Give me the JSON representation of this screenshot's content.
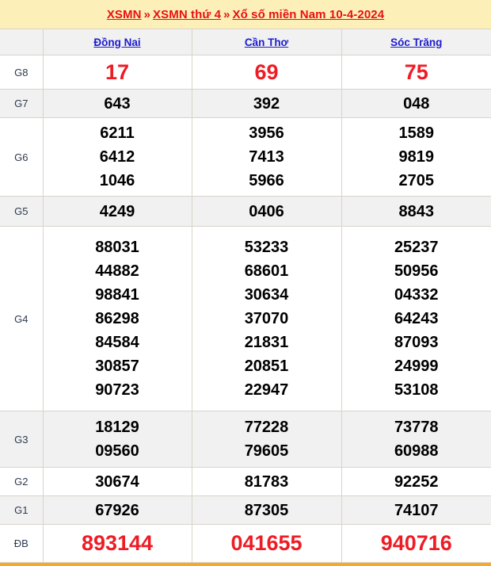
{
  "header": {
    "crumbs": [
      {
        "text": "XSMN",
        "type": "link"
      },
      {
        "text": "»",
        "type": "sep"
      },
      {
        "text": "XSMN thứ 4",
        "type": "link"
      },
      {
        "text": "»",
        "type": "sep"
      },
      {
        "text": "Xổ số miền Nam 10-4-2024",
        "type": "link"
      }
    ],
    "bg_color": "#fdefb8",
    "link_color": "#e8100f"
  },
  "table": {
    "columns": [
      {
        "label": ""
      },
      {
        "label": "Đồng Nai"
      },
      {
        "label": "Cần Thơ"
      },
      {
        "label": "Sóc Trăng"
      }
    ],
    "header_color": "#1b1bcf",
    "highlight_color": "#ee1c25",
    "rows": [
      {
        "prize": "G8",
        "dongnai": [
          "17"
        ],
        "cantho": [
          "69"
        ],
        "soctrang": [
          "75"
        ]
      },
      {
        "prize": "G7",
        "dongnai": [
          "643"
        ],
        "cantho": [
          "392"
        ],
        "soctrang": [
          "048"
        ]
      },
      {
        "prize": "G6",
        "dongnai": [
          "6211",
          "6412",
          "1046"
        ],
        "cantho": [
          "3956",
          "7413",
          "5966"
        ],
        "soctrang": [
          "1589",
          "9819",
          "2705"
        ]
      },
      {
        "prize": "G5",
        "dongnai": [
          "4249"
        ],
        "cantho": [
          "0406"
        ],
        "soctrang": [
          "8843"
        ]
      },
      {
        "prize": "G4",
        "dongnai": [
          "88031",
          "44882",
          "98841",
          "86298",
          "84584",
          "30857",
          "90723"
        ],
        "cantho": [
          "53233",
          "68601",
          "30634",
          "37070",
          "21831",
          "20851",
          "22947"
        ],
        "soctrang": [
          "25237",
          "50956",
          "04332",
          "64243",
          "87093",
          "24999",
          "53108"
        ]
      },
      {
        "prize": "G3",
        "dongnai": [
          "18129",
          "09560"
        ],
        "cantho": [
          "77228",
          "79605"
        ],
        "soctrang": [
          "73778",
          "60988"
        ]
      },
      {
        "prize": "G2",
        "dongnai": [
          "30674"
        ],
        "cantho": [
          "81783"
        ],
        "soctrang": [
          "92252"
        ]
      },
      {
        "prize": "G1",
        "dongnai": [
          "67926"
        ],
        "cantho": [
          "87305"
        ],
        "soctrang": [
          "74107"
        ]
      },
      {
        "prize": "ĐB",
        "dongnai": [
          "893144"
        ],
        "cantho": [
          "041655"
        ],
        "soctrang": [
          "940716"
        ]
      }
    ]
  },
  "footer": {
    "accent_color": "#f5a82a"
  }
}
